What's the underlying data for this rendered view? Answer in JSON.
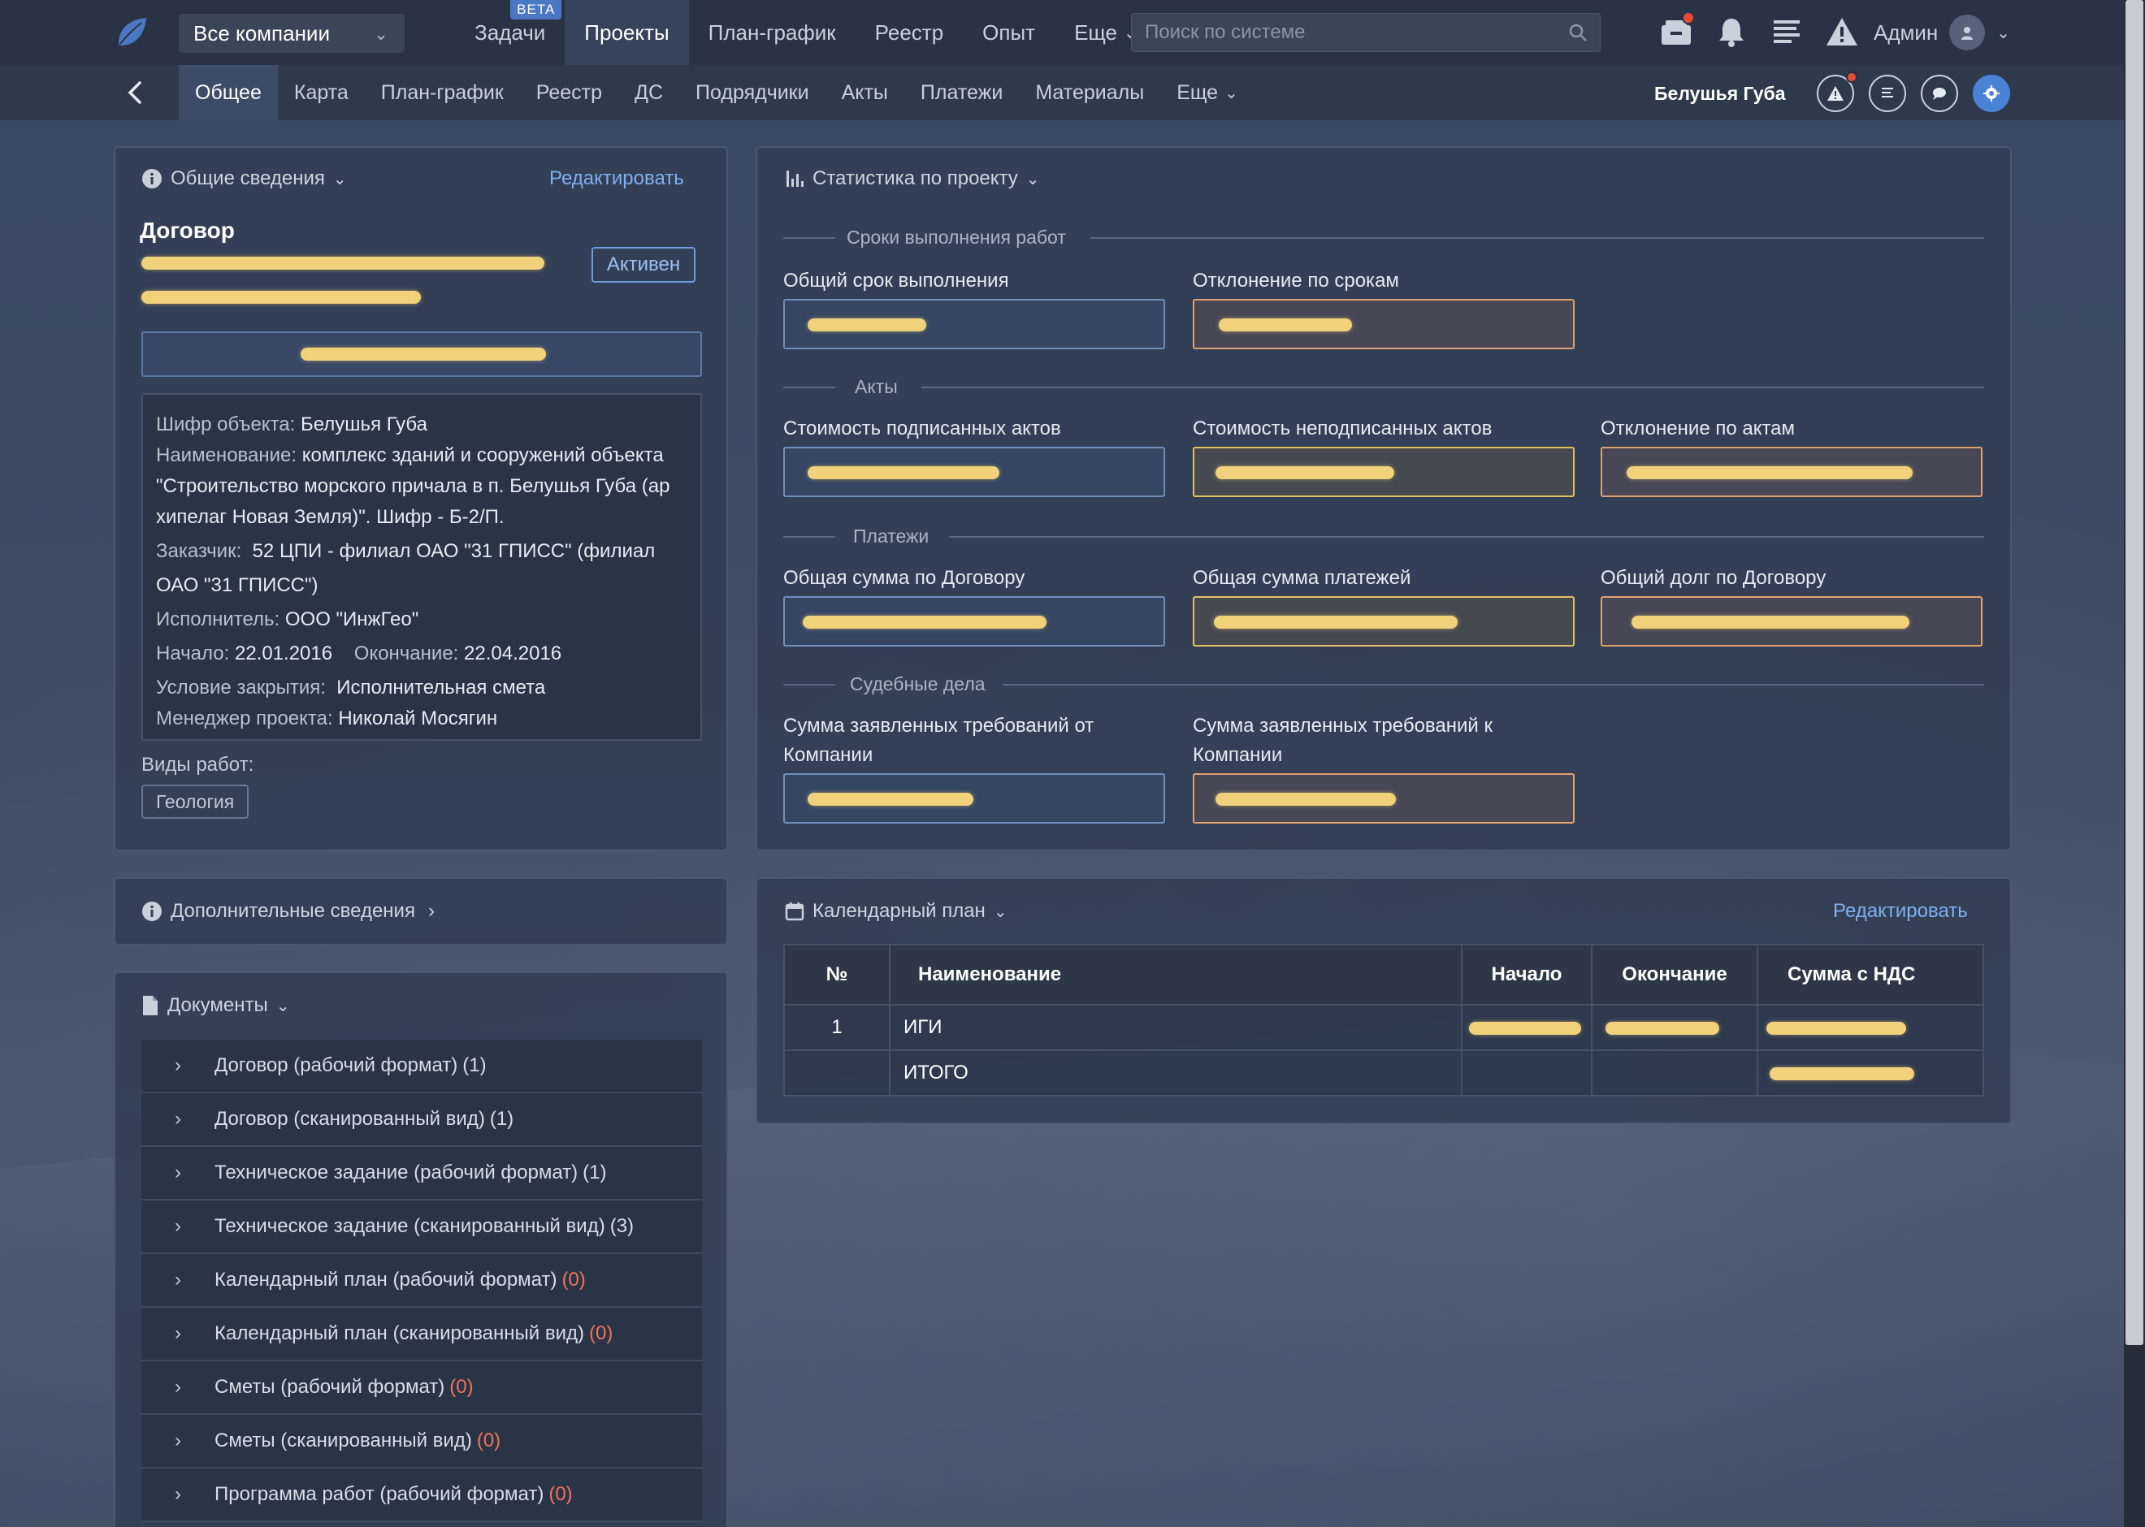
{
  "topbar": {
    "company_select": "Все компании",
    "nav": [
      {
        "label": "Задачи",
        "badge": "BETA"
      },
      {
        "label": "Проекты",
        "active": true
      },
      {
        "label": "План-график"
      },
      {
        "label": "Реестр"
      },
      {
        "label": "Опыт"
      },
      {
        "label": "Еще"
      }
    ],
    "search_placeholder": "Поиск по системе",
    "user_name": "Админ"
  },
  "subbar": {
    "tabs": [
      "Общее",
      "Карта",
      "План-график",
      "Реестр",
      "ДС",
      "Подрядчики",
      "Акты",
      "Платежи",
      "Материалы",
      "Еще"
    ],
    "active_tab": "Общее",
    "project_name": "Белушья Губа"
  },
  "general": {
    "title": "Общие сведения",
    "edit": "Редактировать",
    "contract_heading": "Договор",
    "status": "Активен",
    "info": {
      "cipher_label": "Шифр объекта:",
      "cipher": "Белушья Губа",
      "name_label": "Наименование:",
      "name_line1": "комплекс зданий и сооружений объекта",
      "name_line2": "\"Строительство морского причала в п. Белушья Губа (ар",
      "name_line3": "хипелаг Новая Земля)\". Шифр - Б-2/П.",
      "customer_label": "Заказчик:",
      "customer_line1": "52 ЦПИ - филиал ОАО \"31 ГПИСС\" (филиал",
      "customer_line2": "ОАО \"31 ГПИСС\")",
      "executor_label": "Исполнитель:",
      "executor": "ООО \"ИнжГео\"",
      "start_label": "Начало:",
      "start": "22.01.2016",
      "end_label": "Окончание:",
      "end": "22.04.2016",
      "closing_label": "Условие закрытия:",
      "closing": "Исполнительная смета",
      "manager_label": "Менеджер проекта:",
      "manager": "Николай Мосягин"
    },
    "work_types_label": "Виды работ:",
    "work_types": [
      "Геология"
    ]
  },
  "additional": {
    "title": "Дополнительные сведения"
  },
  "documents": {
    "title": "Документы",
    "items": [
      {
        "label": "Договор (рабочий формат)",
        "count": "(1)",
        "zero": false
      },
      {
        "label": "Договор (сканированный вид)",
        "count": "(1)",
        "zero": false
      },
      {
        "label": "Техническое задание (рабочий формат)",
        "count": "(1)",
        "zero": false
      },
      {
        "label": "Техническое задание (сканированный вид)",
        "count": "(3)",
        "zero": false
      },
      {
        "label": "Календарный план (рабочий формат)",
        "count": "(0)",
        "zero": true
      },
      {
        "label": "Календарный план (сканированный вид)",
        "count": "(0)",
        "zero": true
      },
      {
        "label": "Сметы (рабочий формат)",
        "count": "(0)",
        "zero": true
      },
      {
        "label": "Сметы (сканированный вид)",
        "count": "(0)",
        "zero": true
      },
      {
        "label": "Программа работ (рабочий формат)",
        "count": "(0)",
        "zero": true
      }
    ]
  },
  "stats": {
    "title": "Статистика по проекту",
    "sections": {
      "terms": "Сроки выполнения работ",
      "acts": "Акты",
      "payments": "Платежи",
      "court": "Судебные дела"
    },
    "fields": {
      "total_term": "Общий срок выполнения",
      "term_deviation": "Отклонение по срокам",
      "signed_acts": "Стоимость подписанных актов",
      "unsigned_acts": "Стоимость неподписанных актов",
      "acts_deviation": "Отклонение по актам",
      "contract_total": "Общая сумма по Договору",
      "payments_total": "Общая сумма платежей",
      "contract_debt": "Общий долг по Договору",
      "claims_from_line1": "Сумма заявленных требований от",
      "claims_from_line2": "Компании",
      "claims_to_line1": "Сумма заявленных требований к",
      "claims_to_line2": "Компании"
    }
  },
  "calendar": {
    "title": "Календарный план",
    "edit": "Редактировать",
    "columns": [
      "№",
      "Наименование",
      "Начало",
      "Окончание",
      "Сумма с НДС"
    ],
    "rows": [
      {
        "num": "1",
        "name": "ИГИ"
      },
      {
        "num": "",
        "name": "ИТОГО"
      }
    ]
  }
}
